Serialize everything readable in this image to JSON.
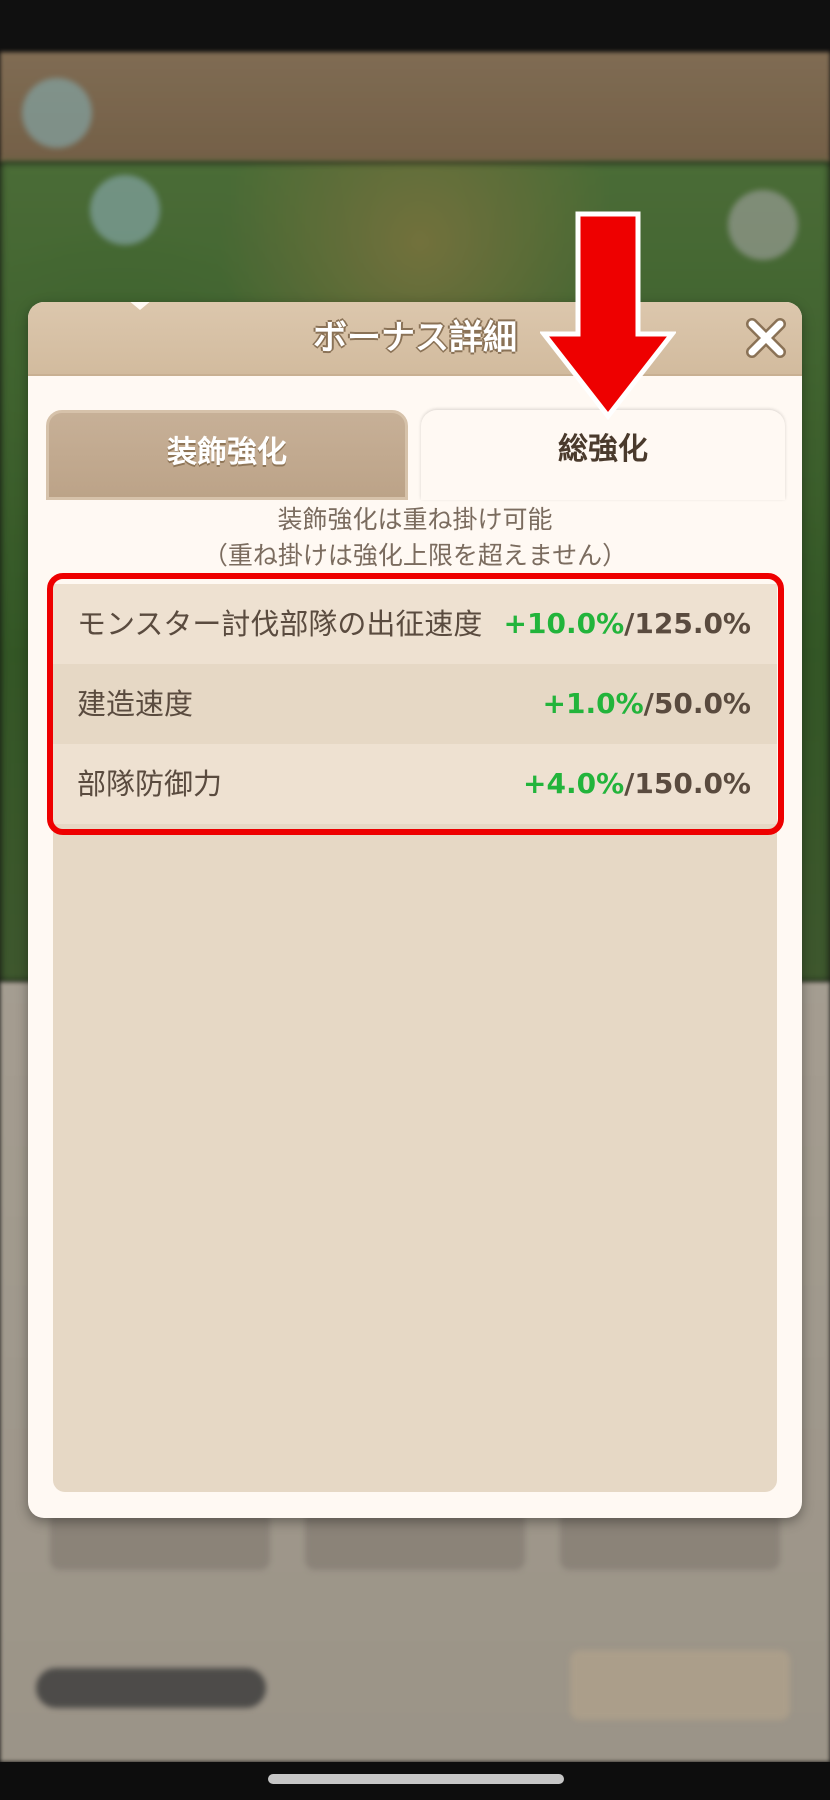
{
  "modal": {
    "title": "ボーナス詳細",
    "tabs": [
      {
        "label": "装飾強化",
        "selected": false
      },
      {
        "label": "総強化",
        "selected": true
      }
    ],
    "note_line1": "装飾強化は重ね掛け可能",
    "note_line2": "（重ね掛けは強化上限を超えません）",
    "stats": [
      {
        "label": "モンスター討伐部隊の出征速度",
        "bonus": "+10.0%",
        "max": "/125.0%"
      },
      {
        "label": "建造速度",
        "bonus": "+1.0%",
        "max": "/50.0%"
      },
      {
        "label": "部隊防御力",
        "bonus": "+4.0%",
        "max": "/150.0%"
      }
    ]
  },
  "colors": {
    "bonus_green": "#22b43b",
    "annotation_red": "#ee0000",
    "header_tan": "#d2bb9e"
  },
  "icons": {
    "close": "close-icon",
    "annotation_arrow": "down-arrow-icon"
  }
}
